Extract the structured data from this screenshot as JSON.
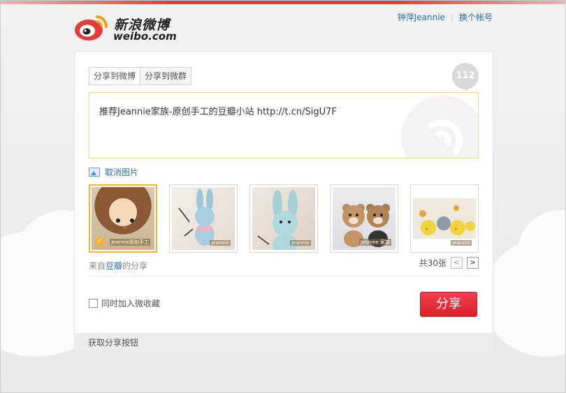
{
  "header": {
    "logo_cn": "新浪微博",
    "logo_en": "weibo.com",
    "user_name": "钟萍Jeannie",
    "switch_account": "换个帐号"
  },
  "tabs": [
    {
      "label": "分享到微博",
      "active": true
    },
    {
      "label": "分享到微群",
      "active": false
    }
  ],
  "counter": "112",
  "post": {
    "text": "推荐Jeannie家族-原创手工的豆瓣小站 http://t.cn/SigU7F"
  },
  "cancel_picture": "取消图片",
  "thumbnails": [
    {
      "name": "doll-face",
      "selected": true,
      "watermark": "Jeannie原创手工"
    },
    {
      "name": "blue-bunny-1",
      "selected": false,
      "watermark": "Jeannie"
    },
    {
      "name": "blue-bunny-2",
      "selected": false,
      "watermark": "Jeannie"
    },
    {
      "name": "teddy-bears",
      "selected": false,
      "watermark": "Jeannie 家族"
    },
    {
      "name": "chicks",
      "selected": false,
      "watermark": "Jeannie"
    }
  ],
  "source": {
    "prefix": "来自",
    "link": "豆瓣",
    "suffix": "的分享"
  },
  "pager": {
    "total": "共30张",
    "prev": "<",
    "next": ">"
  },
  "favorite": {
    "label": "同时加入微收藏",
    "checked": false
  },
  "share_button": "分享",
  "footer": {
    "get_button": "获取分享按钮"
  },
  "colors": {
    "brand_red": "#e43b3b",
    "link_blue": "#2a6fa8",
    "selected_border": "#f2b13a"
  }
}
